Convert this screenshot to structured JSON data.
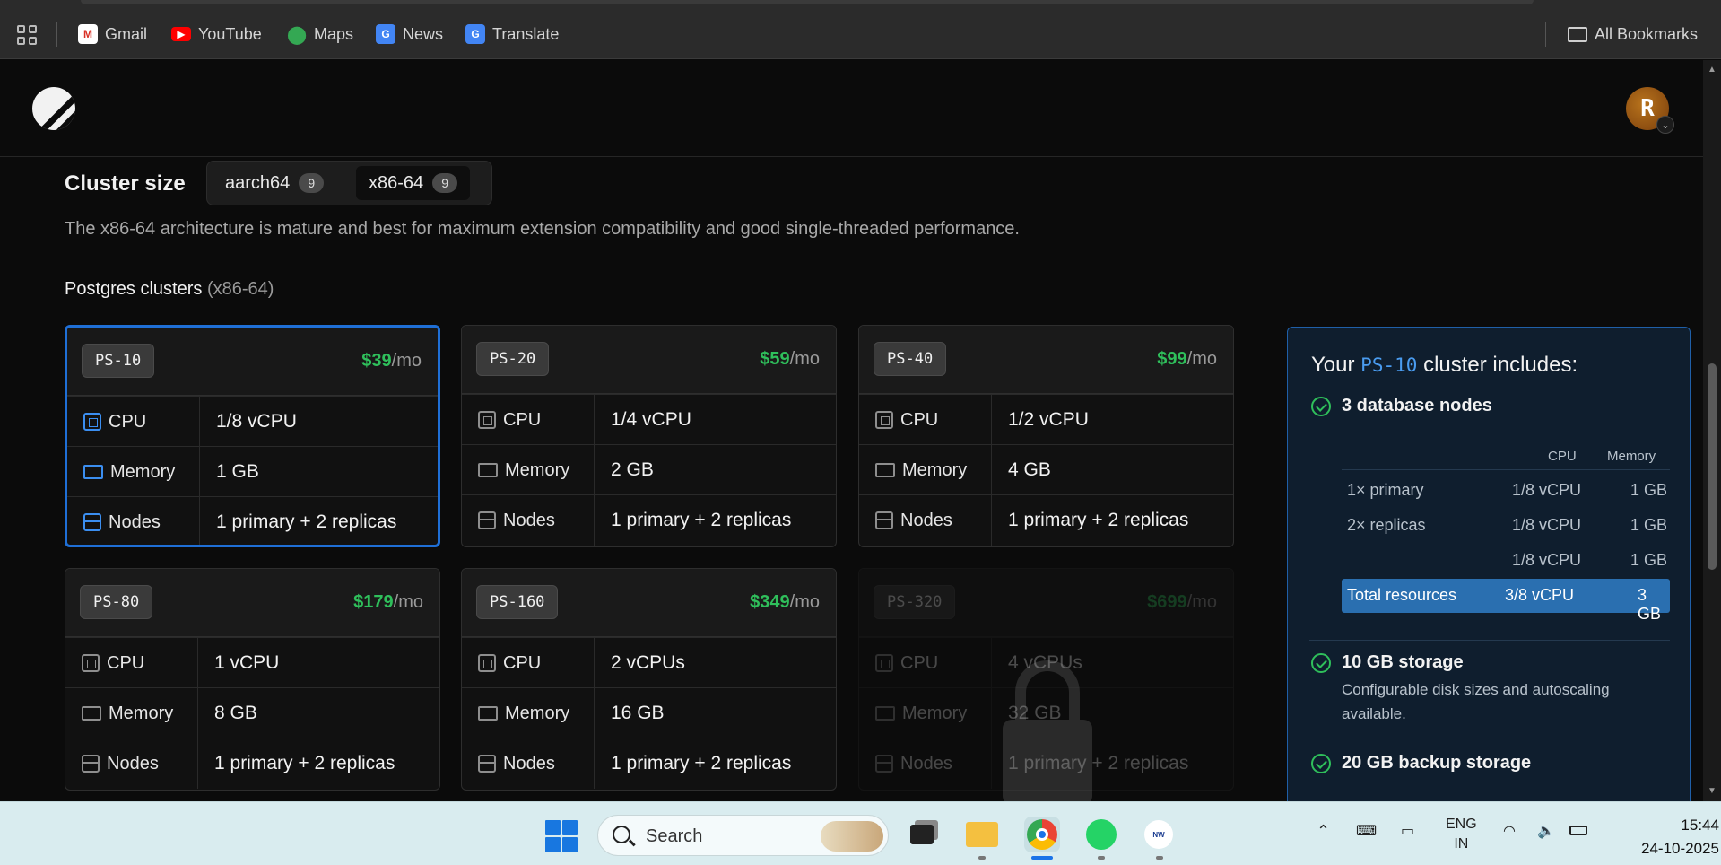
{
  "bookmarks": {
    "items": [
      {
        "label": "Gmail",
        "icon": "gmail-icon"
      },
      {
        "label": "YouTube",
        "icon": "youtube-icon"
      },
      {
        "label": "Maps",
        "icon": "maps-icon"
      },
      {
        "label": "News",
        "icon": "news-icon"
      },
      {
        "label": "Translate",
        "icon": "translate-icon"
      }
    ],
    "all_bookmarks": "All Bookmarks"
  },
  "header": {
    "avatar_letter": "R"
  },
  "cluster": {
    "title": "Cluster size",
    "arch_options": [
      {
        "label": "aarch64",
        "count": "9"
      },
      {
        "label": "x86-64",
        "count": "9"
      }
    ],
    "selected_arch": "x86-64",
    "description": "The x86-64 architecture is mature and best for maximum extension compatibility and good single-threaded performance.",
    "heading": "Postgres clusters",
    "heading_suffix": "(x86-64)"
  },
  "labels": {
    "cpu": "CPU",
    "memory": "Memory",
    "nodes": "Nodes",
    "per_month": "/mo"
  },
  "plans": [
    {
      "code": "PS-10",
      "price": "$39",
      "cpu": "1/8 vCPU",
      "memory": "1 GB",
      "nodes": "1 primary + 2 replicas"
    },
    {
      "code": "PS-20",
      "price": "$59",
      "cpu": "1/4 vCPU",
      "memory": "2 GB",
      "nodes": "1 primary + 2 replicas"
    },
    {
      "code": "PS-40",
      "price": "$99",
      "cpu": "1/2 vCPU",
      "memory": "4 GB",
      "nodes": "1 primary + 2 replicas"
    },
    {
      "code": "PS-80",
      "price": "$179",
      "cpu": "1 vCPU",
      "memory": "8 GB",
      "nodes": "1 primary + 2 replicas"
    },
    {
      "code": "PS-160",
      "price": "$349",
      "cpu": "2 vCPUs",
      "memory": "16 GB",
      "nodes": "1 primary + 2 replicas"
    },
    {
      "code": "PS-320",
      "price": "$699",
      "cpu": "4 vCPUs",
      "memory": "32 GB",
      "nodes": "1 primary + 2 replicas"
    }
  ],
  "summary": {
    "title_prefix": "Your",
    "title_code": "PS-10",
    "title_suffix": "cluster includes:",
    "db_nodes": "3 database nodes",
    "col_cpu": "CPU",
    "col_memory": "Memory",
    "rows": [
      {
        "label": "1× primary",
        "cpu": "1/8 vCPU",
        "memory": "1 GB"
      },
      {
        "label": "2× replicas",
        "cpu": "1/8 vCPU",
        "memory": "1 GB"
      },
      {
        "label": "",
        "cpu": "1/8 vCPU",
        "memory": "1 GB"
      }
    ],
    "total": {
      "label": "Total resources",
      "cpu": "3/8 vCPU",
      "memory": "3 GB"
    },
    "storage": "10 GB storage",
    "storage_desc": "Configurable disk sizes and autoscaling available.",
    "backup": "20 GB backup storage"
  },
  "taskbar": {
    "search": "Search",
    "lang_1": "ENG",
    "lang_2": "IN",
    "time": "15:44",
    "date": "24-10-2025"
  },
  "colors": {
    "accent": "#1f6fd6",
    "price_green": "#2fbf5b",
    "summary_bg": "#0f1e2e"
  }
}
